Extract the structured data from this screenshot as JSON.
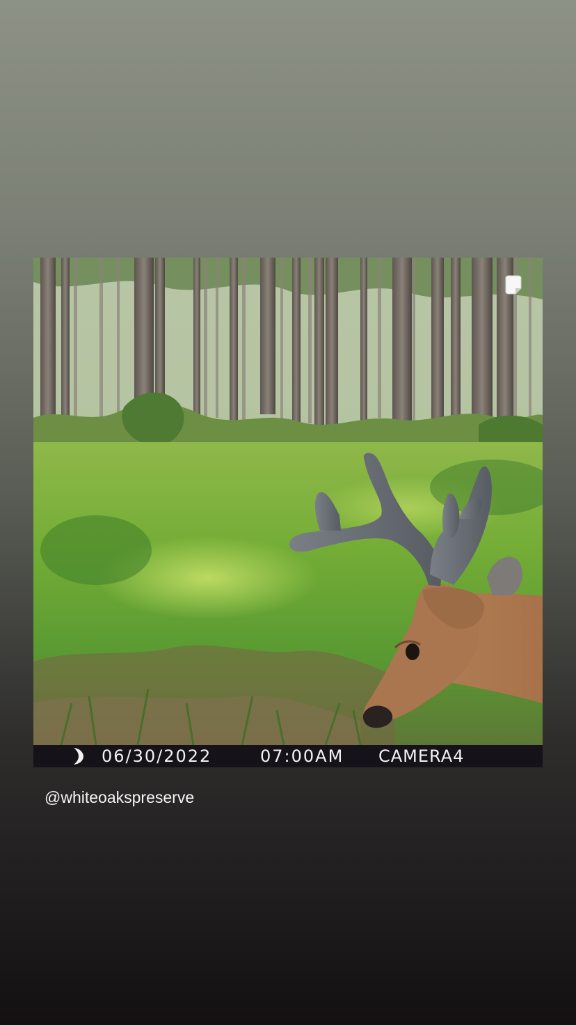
{
  "trail_camera": {
    "date": "06/30/2022",
    "time": "07:00AM",
    "camera": "CAMERA4"
  },
  "story": {
    "mention": "@whiteoakspreserve"
  },
  "icons": {
    "moon": "moon-icon",
    "sticker": "sticker-icon"
  },
  "colors": {
    "caption_bar": "#16121a",
    "caption_text": "#f2f2f2"
  }
}
